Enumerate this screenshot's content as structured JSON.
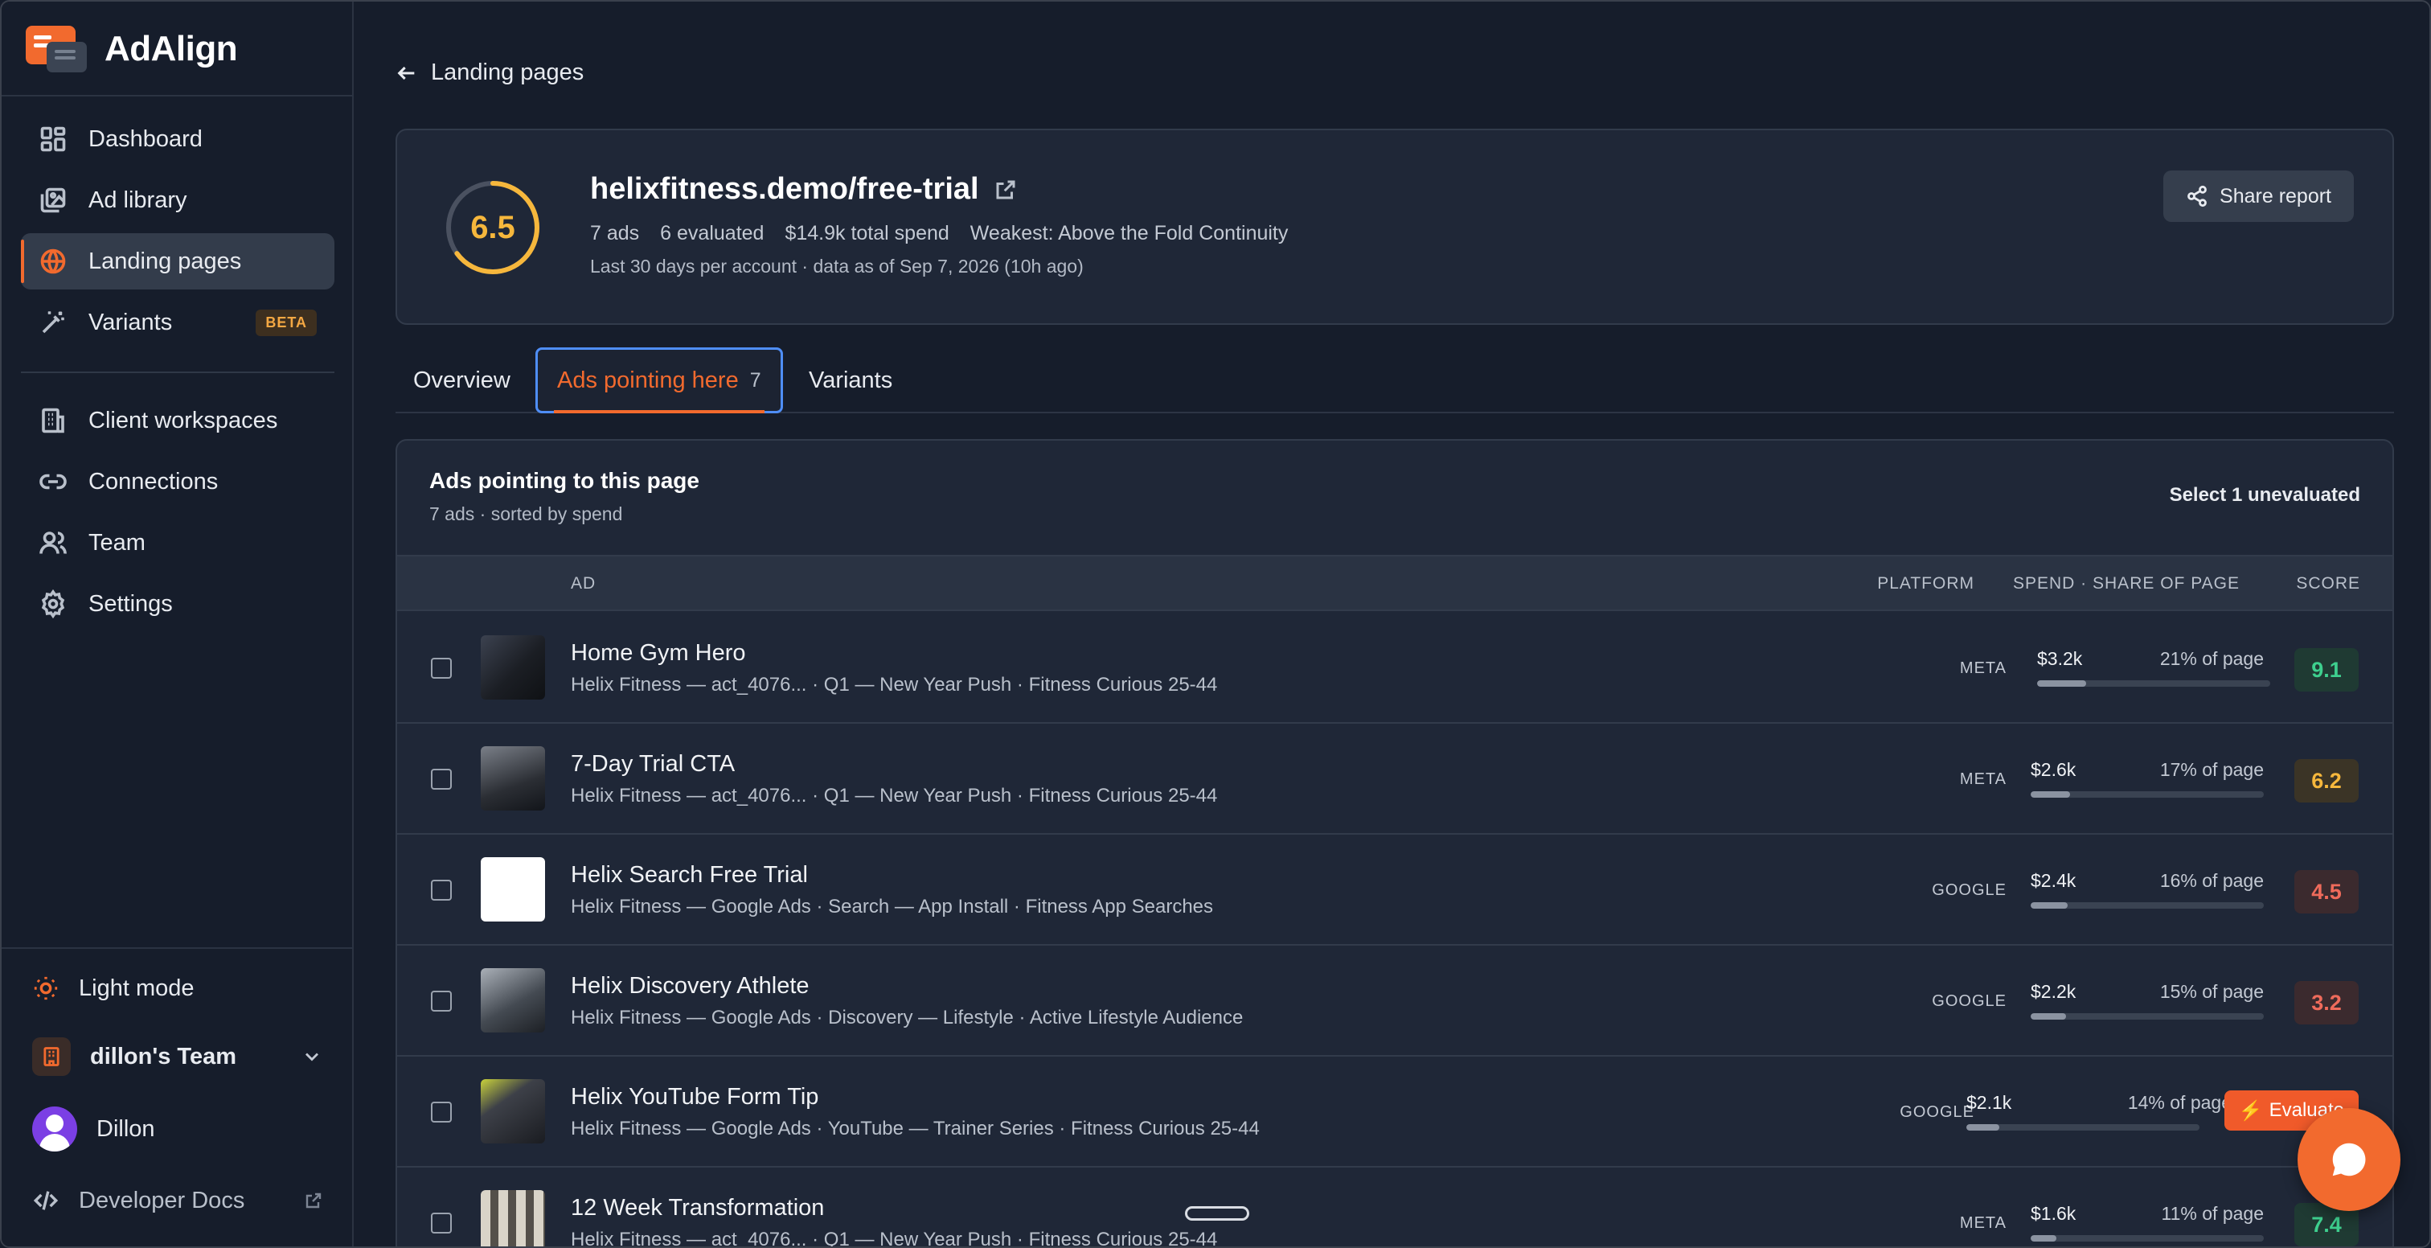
{
  "app": {
    "name": "AdAlign"
  },
  "sidebar": {
    "nav": [
      {
        "label": "Dashboard",
        "icon": "grid-icon"
      },
      {
        "label": "Ad library",
        "icon": "image-stack-icon"
      },
      {
        "label": "Landing pages",
        "icon": "globe-icon",
        "active": true
      },
      {
        "label": "Variants",
        "icon": "magic-wand-icon",
        "badge": "BETA"
      }
    ],
    "nav2": [
      {
        "label": "Client workspaces",
        "icon": "building-icon"
      },
      {
        "label": "Connections",
        "icon": "link-icon"
      },
      {
        "label": "Team",
        "icon": "users-icon"
      },
      {
        "label": "Settings",
        "icon": "gear-icon"
      }
    ],
    "light_mode": "Light mode",
    "team_name": "dillon's Team",
    "user_name": "Dillon",
    "developer_docs": "Developer Docs"
  },
  "breadcrumb": {
    "back_label": "Landing pages"
  },
  "header": {
    "score": "6.5",
    "url": "helixfitness.demo/free-trial",
    "ads": "7 ads",
    "evaluated": "6 evaluated",
    "spend": "$14.9k total spend",
    "weakest": "Weakest: Above the Fold Continuity",
    "sub": "Last 30 days per account · data as of Sep 7, 2026 (10h ago)",
    "share_label": "Share report"
  },
  "tabs": [
    {
      "label": "Overview"
    },
    {
      "label": "Ads pointing here",
      "count": "7",
      "active": true
    },
    {
      "label": "Variants"
    }
  ],
  "table": {
    "title": "Ads pointing to this page",
    "subtitle": "7 ads · sorted by spend",
    "select_label": "Select 1 unevaluated",
    "columns": {
      "ad": "AD",
      "platform": "PLATFORM",
      "spend": "SPEND · SHARE OF PAGE",
      "score": "SCORE"
    },
    "rows": [
      {
        "name": "Home Gym Hero",
        "sub": "Helix Fitness — act_4076... · Q1 — New Year Push · Fitness Curious 25-44",
        "platform": "META",
        "spend": "$3.2k",
        "share": "21% of page",
        "share_fraction": 0.21,
        "score": "9.1"
      },
      {
        "name": "7-Day Trial CTA",
        "sub": "Helix Fitness — act_4076... · Q1 — New Year Push · Fitness Curious 25-44",
        "platform": "META",
        "spend": "$2.6k",
        "share": "17% of page",
        "share_fraction": 0.17,
        "score": "6.2"
      },
      {
        "name": "Helix Search Free Trial",
        "sub": "Helix Fitness — Google Ads · Search — App Install · Fitness App Searches",
        "platform": "GOOGLE",
        "spend": "$2.4k",
        "share": "16% of page",
        "share_fraction": 0.16,
        "score": "4.5"
      },
      {
        "name": "Helix Discovery Athlete",
        "sub": "Helix Fitness — Google Ads · Discovery — Lifestyle · Active Lifestyle Audience",
        "platform": "GOOGLE",
        "spend": "$2.2k",
        "share": "15% of page",
        "share_fraction": 0.15,
        "score": "3.2"
      },
      {
        "name": "Helix YouTube Form Tip",
        "sub": "Helix Fitness — Google Ads · YouTube — Trainer Series · Fitness Curious 25-44",
        "platform": "GOOGLE",
        "spend": "$2.1k",
        "share": "14% of page",
        "share_fraction": 0.14,
        "evaluate_label": "Evaluate"
      },
      {
        "name": "12 Week Transformation",
        "sub": "Helix Fitness — act_4076... · Q1 — New Year Push · Fitness Curious 25-44",
        "platform": "META",
        "spend": "$1.6k",
        "share": "11% of page",
        "share_fraction": 0.11,
        "score": "7.4"
      }
    ]
  },
  "colors": {
    "accent": "#f26a2e",
    "score_high": "#3ecf8e",
    "score_mid": "#f6b73c",
    "score_low": "#ef6b5b"
  }
}
